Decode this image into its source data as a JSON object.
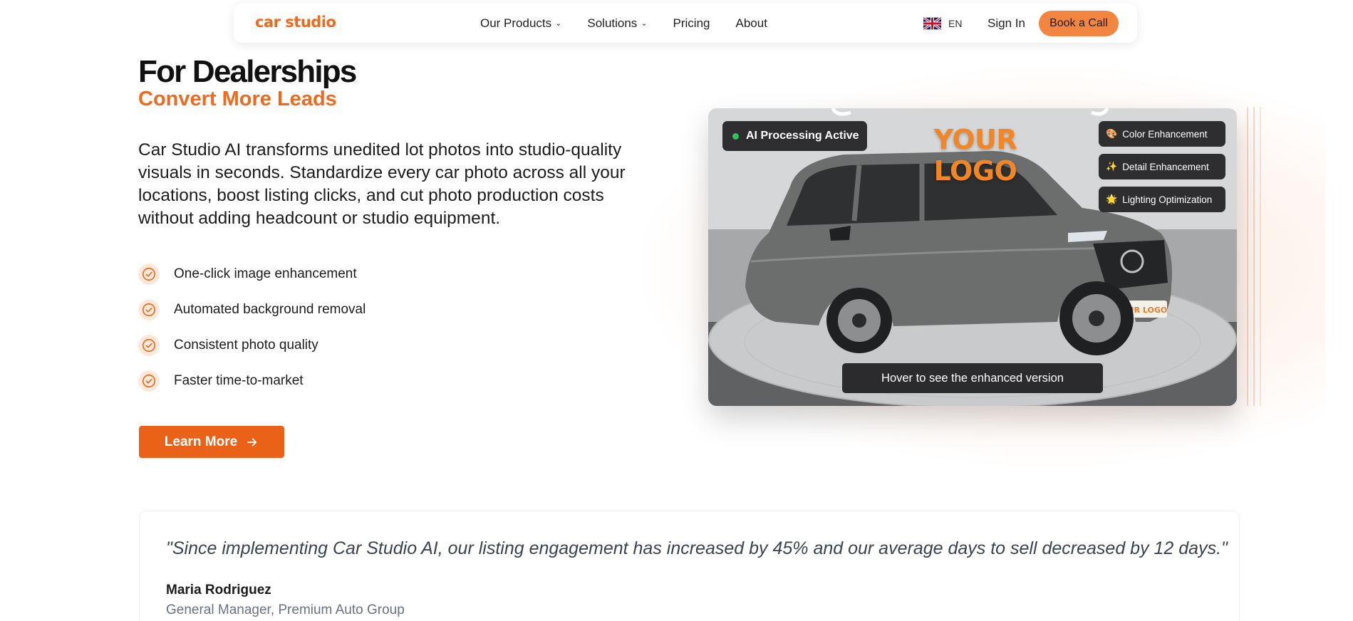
{
  "nav": {
    "logo": "car studio",
    "links": [
      {
        "label": "Our Products",
        "dropdown": true
      },
      {
        "label": "Solutions",
        "dropdown": true
      },
      {
        "label": "Pricing",
        "dropdown": false
      },
      {
        "label": "About",
        "dropdown": false
      }
    ],
    "language": "EN",
    "sign_in": "Sign In",
    "cta": "Book a Call"
  },
  "hero": {
    "title": "For Dealerships",
    "subtitle": "Convert More Leads",
    "description": "Car Studio AI transforms unedited lot photos into studio-quality visuals in seconds. Standardize every car photo across all your locations, boost listing clicks, and cut photo production costs without adding headcount or studio equipment.",
    "features": [
      "One-click image enhancement",
      "Automated background removal",
      "Consistent photo quality",
      "Faster time-to-market"
    ],
    "learn_more": "Learn More"
  },
  "photo": {
    "status_badge": "AI Processing Active",
    "logo_text": "YOUR LOGO",
    "plate_text": "YOUR LOGO",
    "tags": [
      {
        "icon": "palette-icon",
        "glyph": "🎨",
        "label": "Color Enhancement"
      },
      {
        "icon": "sparkles-icon",
        "glyph": "✨",
        "label": "Detail Enhancement"
      },
      {
        "icon": "sun-icon",
        "glyph": "🌟",
        "label": "Lighting Optimization"
      }
    ],
    "hover_message": "Hover to see the enhanced version"
  },
  "testimonial": {
    "quote": "\"Since implementing Car Studio AI, our listing engagement has increased by 45% and our average days to sell decreased by 12 days.\"",
    "name": "Maria Rodriguez",
    "role": "General Manager, Premium Auto Group"
  },
  "colors": {
    "accent": "#ee6a1f",
    "cta_bg": "#f2853f",
    "button_bg": "#ea6218",
    "status_dot": "#2ec265"
  }
}
